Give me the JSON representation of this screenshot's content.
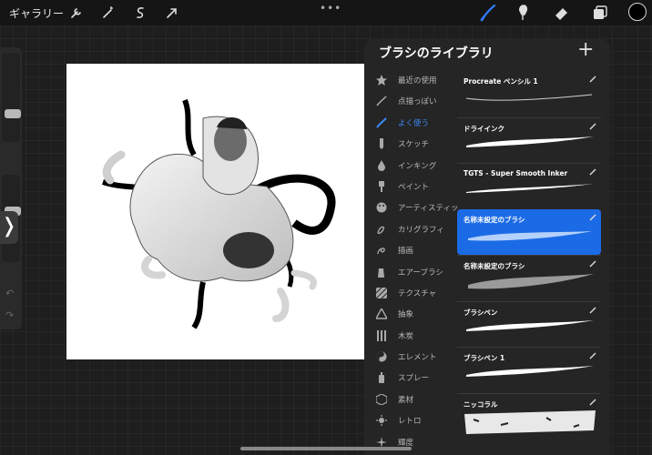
{
  "topbar": {
    "gallery_label": "ギャラリー",
    "left_tools": [
      "wrench-icon",
      "magic-wand-icon",
      "selection-icon",
      "transform-arrow-icon"
    ],
    "more": "•••",
    "right_tools": [
      "brush-icon",
      "smudge-icon",
      "eraser-icon",
      "layers-icon"
    ],
    "active_tool": "brush-icon",
    "current_color": "#000000",
    "accent_color": "#2f7cff"
  },
  "sidebar": {
    "brush_size_level": 0.2,
    "opacity_level": 0.25
  },
  "panel": {
    "title": "ブラシのライブラリ",
    "add_symbol": "+",
    "categories": [
      {
        "label": "最近の使用",
        "icon": "star-icon"
      },
      {
        "label": "点描っぽい",
        "icon": "feather-stroke-icon"
      },
      {
        "label": "よく使う",
        "icon": "brush-stroke-icon",
        "active": true
      },
      {
        "label": "スケッチ",
        "icon": "pencil-icon"
      },
      {
        "label": "インキング",
        "icon": "ink-drop-icon"
      },
      {
        "label": "ペイント",
        "icon": "paint-brush-icon"
      },
      {
        "label": "アーティスティック",
        "icon": "palette-icon"
      },
      {
        "label": "カリグラフィ",
        "icon": "calligraphy-icon"
      },
      {
        "label": "描画",
        "icon": "scribble-icon"
      },
      {
        "label": "エアーブラシ",
        "icon": "airbrush-icon"
      },
      {
        "label": "テクスチャ",
        "icon": "texture-icon"
      },
      {
        "label": "抽象",
        "icon": "triangle-icon"
      },
      {
        "label": "木炭",
        "icon": "charcoal-icon"
      },
      {
        "label": "エレメント",
        "icon": "yin-yang-icon"
      },
      {
        "label": "スプレー",
        "icon": "spray-can-icon"
      },
      {
        "label": "素材",
        "icon": "cube-icon"
      },
      {
        "label": "レトロ",
        "icon": "retro-sun-icon"
      },
      {
        "label": "輝度",
        "icon": "sparkle-icon"
      }
    ],
    "brushes": [
      {
        "name": "Procreate ペンシル 1",
        "stroke": "pencil"
      },
      {
        "name": "ドライインク",
        "stroke": "taper"
      },
      {
        "name": "TGTS - Super Smooth Inker",
        "stroke": "thin"
      },
      {
        "name": "名称未設定のブラシ",
        "stroke": "noise",
        "selected": true
      },
      {
        "name": "名称未設定のブラシ",
        "stroke": "speckle"
      },
      {
        "name": "ブラシペン",
        "stroke": "taper"
      },
      {
        "name": "ブラシペン 1",
        "stroke": "taper"
      },
      {
        "name": "ニッコラル",
        "stroke": "grunge"
      }
    ]
  }
}
